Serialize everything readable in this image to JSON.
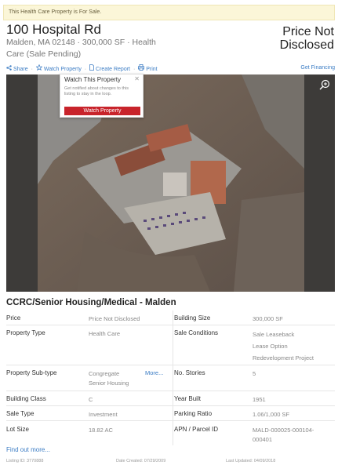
{
  "banner": "This Health Care Property is For Sale.",
  "property": {
    "title": "100 Hospital Rd",
    "subtitle": "Malden, MA 02148 · 300,000 SF · Health Care (Sale Pending)",
    "price_line1": "Price Not",
    "price_line2": "Disclosed"
  },
  "actions": {
    "share": "Share",
    "watch": "Watch Property",
    "create_report": "Create Report",
    "print": "Print",
    "get_financing": "Get Financing"
  },
  "popup": {
    "title": "Watch This Property",
    "text": "Get notified about changes to this listing to stay in the loop.",
    "button": "Watch Property"
  },
  "section_title": "CCRC/Senior Housing/Medical - Malden",
  "details": {
    "price_label": "Price",
    "price_value": "Price Not Disclosed",
    "size_label": "Building Size",
    "size_value": "300,000 SF",
    "type_label": "Property Type",
    "type_value": "Health Care",
    "cond_label": "Sale Conditions",
    "cond_values": [
      "Sale Leaseback",
      "Lease Option",
      "Redevelopment Project"
    ],
    "subtype_label": "Property Sub-type",
    "subtype_value_1": "Congregate",
    "subtype_value_2": "Senior Housing",
    "subtype_more": "More...",
    "stories_label": "No. Stories",
    "stories_value": "5",
    "class_label": "Building Class",
    "class_value": "C",
    "built_label": "Year Built",
    "built_value": "1951",
    "saletype_label": "Sale Type",
    "saletype_value": "Investment",
    "parking_label": "Parking Ratio",
    "parking_value": "1.06/1,000 SF",
    "lot_label": "Lot Size",
    "lot_value": "18.82 AC",
    "apn_label": "APN / Parcel ID",
    "apn_value_1": "MALD-000025-000104-",
    "apn_value_2": "000401"
  },
  "find_more": "Find out more...",
  "footer": {
    "listing_id": "Listing ID: 3770888",
    "date_created": "Date Created: 07/29/2009",
    "last_updated": "Last Updated: 04/09/2018"
  },
  "icons": {
    "share": "share-icon",
    "watch": "star-icon",
    "report": "document-icon",
    "print": "printer-icon",
    "zoom": "zoom-in-icon",
    "close": "close-icon"
  },
  "colors": {
    "link": "#3b7cc4",
    "cta": "#c8242b",
    "banner_bg": "#fbf6d8"
  }
}
